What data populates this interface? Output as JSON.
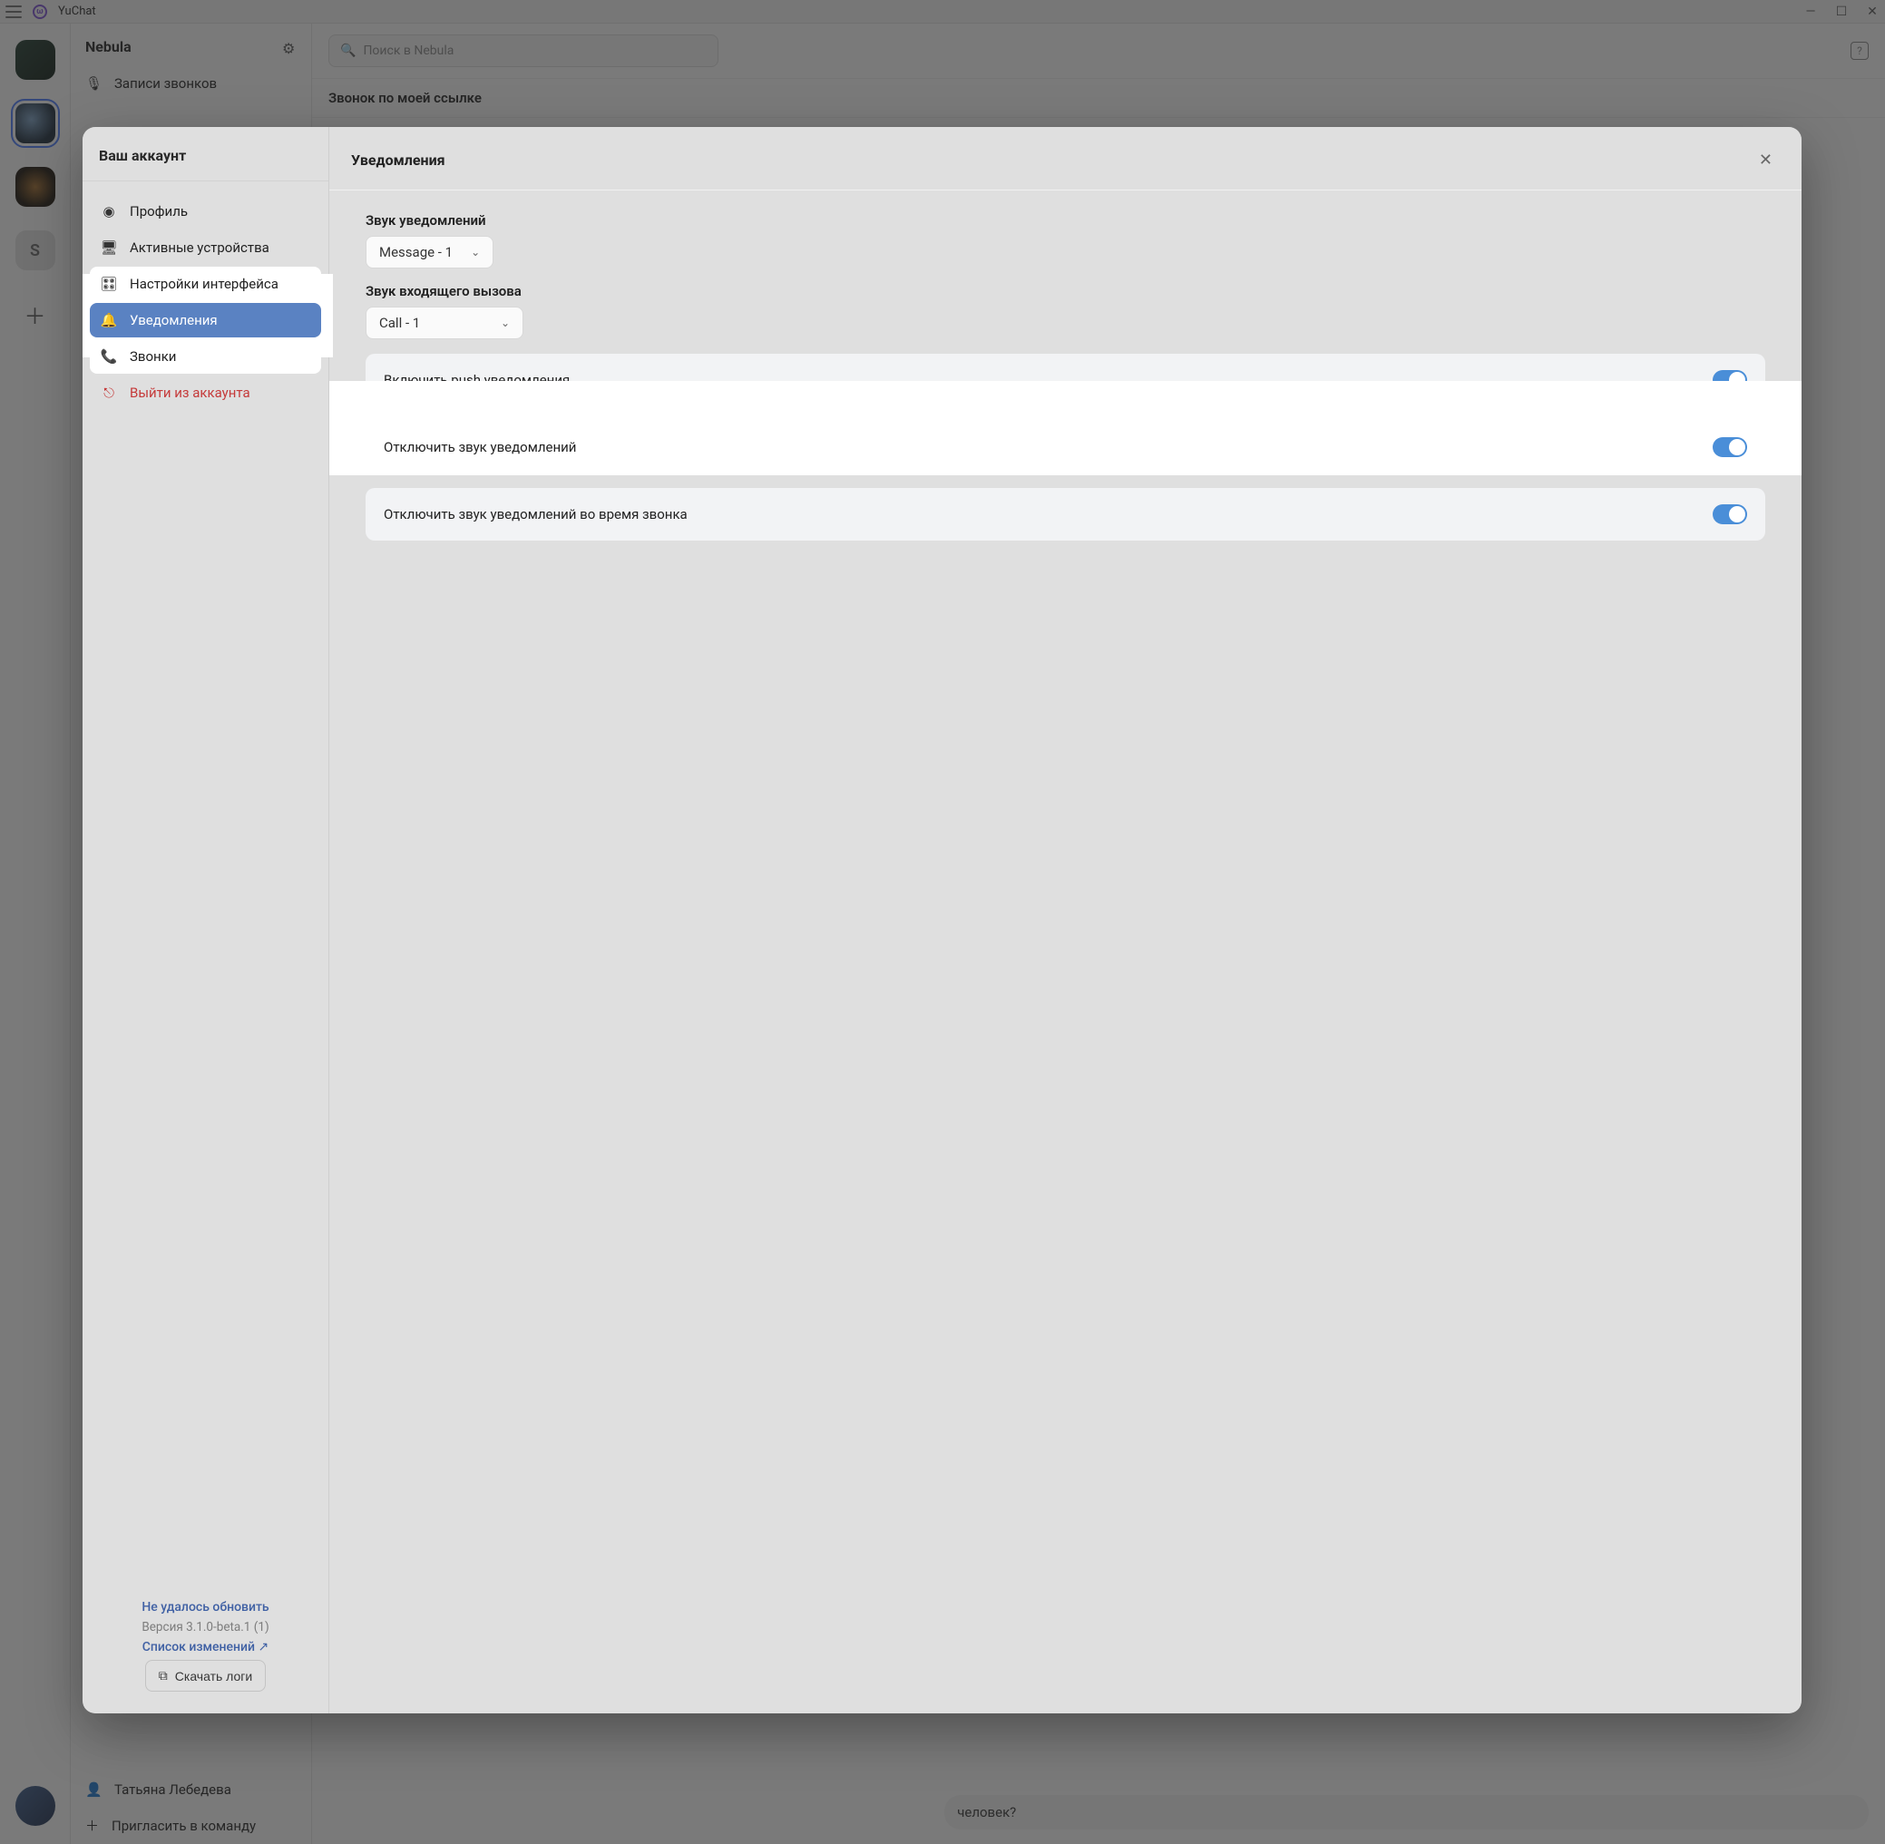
{
  "app": {
    "name": "YuChat"
  },
  "window": {
    "minimize": "–",
    "maximize": "▢",
    "close": "✕"
  },
  "rail": {
    "servers": [
      {
        "name": "server-1"
      },
      {
        "name": "server-2",
        "selected": true
      },
      {
        "name": "server-3"
      },
      {
        "name": "server-s",
        "letter": "S"
      }
    ]
  },
  "sidebar": {
    "workspace": "Nebula",
    "recordings": "Записи звонков",
    "contact_name": "Татьяна Лебедева",
    "invite": "Пригласить в команду"
  },
  "main": {
    "search_placeholder": "Поиск в Nebula",
    "link_call_title": "Звонок по моей ссылке",
    "bubble_text": "человек?"
  },
  "modal": {
    "sidebar_title": "Ваш аккаунт",
    "nav": {
      "profile": "Профиль",
      "devices": "Активные устройства",
      "ui": "Настройки интерфейса",
      "notifications": "Уведомления",
      "calls": "Звонки",
      "logout": "Выйти из аккаунта"
    },
    "footer": {
      "update_failed": "Не удалось обновить",
      "version": "Версия 3.1.0-beta.1 (1)",
      "changelog": "Список изменений ↗",
      "download_logs": "Скачать логи"
    },
    "main_title": "Уведомления",
    "sections": {
      "sound_label": "Звук уведомлений",
      "sound_value": "Message - 1",
      "call_sound_label": "Звук входящего вызова",
      "call_sound_value": "Call - 1"
    },
    "toggles": {
      "push": {
        "label": "Включить push уведомления",
        "on": true
      },
      "mute": {
        "label": "Отключить звук уведомлений",
        "on": true
      },
      "mute_call": {
        "label": "Отключить звук уведомлений во время звонка",
        "on": true
      }
    }
  }
}
